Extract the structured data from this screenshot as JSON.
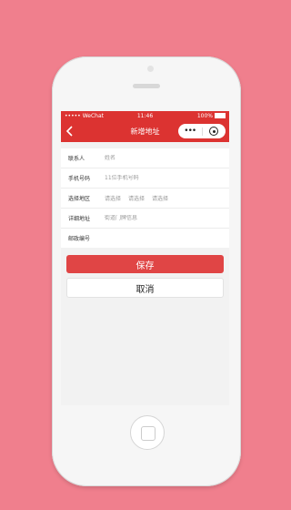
{
  "status": {
    "carrier": "WeChat",
    "signal": "•••••",
    "time": "11:46",
    "battery": "100%",
    "battery_level": 1.0
  },
  "nav": {
    "title": "新增地址",
    "more": "•••"
  },
  "form": {
    "contact": {
      "label": "联系人",
      "placeholder": "姓名"
    },
    "phone": {
      "label": "手机号码",
      "placeholder": "11位手机号码"
    },
    "region": {
      "label": "选择地区",
      "options": [
        "请选择",
        "请选择",
        "请选择"
      ]
    },
    "address": {
      "label": "详细地址",
      "placeholder": "街道门牌信息"
    },
    "postcode": {
      "label": "邮政编号",
      "placeholder": ""
    }
  },
  "actions": {
    "save": "保存",
    "cancel": "取消"
  },
  "colors": {
    "accent": "#dc3331",
    "background": "#f07f8d",
    "save_button": "#e04545"
  }
}
